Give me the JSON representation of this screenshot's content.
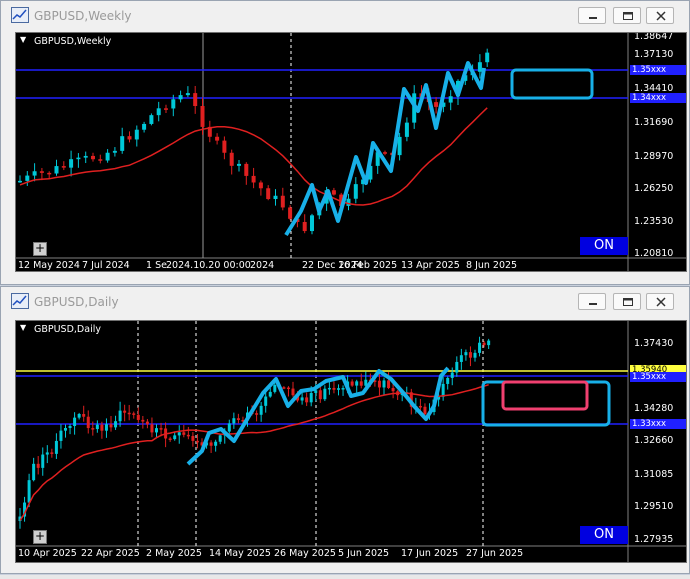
{
  "top_window": {
    "title": "GBPUSD,Weekly",
    "chart_label": "GBPUSD,Weekly",
    "prices": [
      "1.38647",
      "1.37130",
      "1.34410",
      "1.31690",
      "1.28970",
      "1.26250",
      "1.23530",
      "1.20810"
    ],
    "dates": [
      "12 May 2024",
      "7 Jul 2024",
      "1 Se",
      "2024.10.20 00:00",
      "2024",
      "22 Dec 2024",
      "16 Feb 2025",
      "13 Apr 2025",
      "8 Jun 2025"
    ],
    "tag_blue_1": "1.35xxx",
    "tag_blue_2": "1.34xxx",
    "on_label": "ON"
  },
  "bottom_window": {
    "title": "GBPUSD,Daily",
    "chart_label": "GBPUSD,Daily",
    "prices": [
      "1.37430",
      "1.35940",
      "1.34280",
      "1.32660",
      "1.31085",
      "1.29510",
      "1.27935"
    ],
    "dates": [
      "10 Apr 2025",
      "22 Apr 2025",
      "2 May 2025",
      "14 May 2025",
      "26 May 2025",
      "5 Jun 2025",
      "17 Jun 2025",
      "27 Jun 2025"
    ],
    "tag_yellow": "1.35940",
    "tag_blue_1": "1.35xxx",
    "tag_blue_2": "1.33xxx",
    "on_label": "ON"
  },
  "colors": {
    "bull": "#00c8d8",
    "bear": "#e02020",
    "ma": "#e02020",
    "hline": "#2020ff",
    "yline": "#ffff40",
    "highlight": "#18b0e8",
    "highlight_inner": "#f04070"
  }
}
